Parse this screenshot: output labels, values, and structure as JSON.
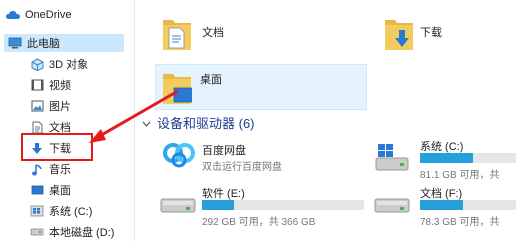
{
  "sidebar": {
    "items": [
      {
        "label": "OneDrive",
        "icon": "cloud-icon"
      },
      {
        "label": "此电脑",
        "icon": "computer-icon",
        "selected": true
      },
      {
        "label": "3D 对象",
        "icon": "cube-icon"
      },
      {
        "label": "视频",
        "icon": "video-icon"
      },
      {
        "label": "图片",
        "icon": "picture-icon"
      },
      {
        "label": "文档",
        "icon": "document-icon"
      },
      {
        "label": "下载",
        "icon": "download-icon",
        "highlighted": true
      },
      {
        "label": "音乐",
        "icon": "music-icon"
      },
      {
        "label": "桌面",
        "icon": "desktop-icon"
      },
      {
        "label": "系统 (C:)",
        "icon": "windows-drive-icon"
      },
      {
        "label": "本地磁盘 (D:)",
        "icon": "drive-icon"
      }
    ]
  },
  "folders": [
    {
      "label": "文档",
      "icon": "document-folder-icon"
    },
    {
      "label": "下载",
      "icon": "download-folder-icon"
    },
    {
      "label": "桌面",
      "icon": "desktop-folder-icon",
      "selected": true
    }
  ],
  "devices": {
    "title": "设备和驱动器 (6)",
    "items": [
      {
        "name": "百度网盘",
        "subtitle": "双击运行百度网盘",
        "icon": "baidu-netdisk-icon"
      },
      {
        "name": "系统 (C:)",
        "free_text": "81.1 GB 可用，共",
        "used_fraction": 0.55,
        "icon": "windows-drive-icon"
      },
      {
        "name": "软件 (E:)",
        "free_text": "292 GB 可用，共 366 GB",
        "used_fraction": 0.2,
        "icon": "drive-icon"
      },
      {
        "name": "文档 (F:)",
        "free_text": "78.3 GB 可用，共",
        "used_fraction": 0.45,
        "icon": "drive-icon"
      }
    ]
  },
  "colors": {
    "accent": "#26a0da",
    "callout": "#e31b1b",
    "selection": "#cce8ff"
  }
}
